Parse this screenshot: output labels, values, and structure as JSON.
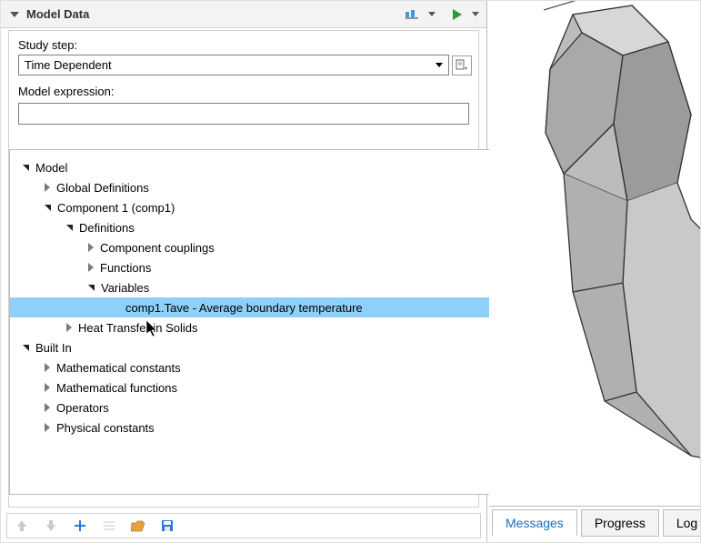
{
  "panel": {
    "title": "Model Data",
    "study_step_label": "Study step:",
    "study_step_value": "Time Dependent",
    "model_expression_label": "Model expression:",
    "model_expression_value": ""
  },
  "tree": {
    "items": [
      {
        "depth": 0,
        "state": "open",
        "label": "Model"
      },
      {
        "depth": 1,
        "state": "closed",
        "label": "Global Definitions"
      },
      {
        "depth": 1,
        "state": "open",
        "label": "Component 1 (comp1)"
      },
      {
        "depth": 2,
        "state": "open",
        "label": "Definitions"
      },
      {
        "depth": 3,
        "state": "closed",
        "label": "Component couplings"
      },
      {
        "depth": 3,
        "state": "closed",
        "label": "Functions"
      },
      {
        "depth": 3,
        "state": "open",
        "label": "Variables"
      },
      {
        "depth": 4,
        "state": "leaf",
        "label": "comp1.Tave - Average boundary temperature",
        "selected": true
      },
      {
        "depth": 2,
        "state": "closed",
        "label": "Heat Transfer in Solids"
      },
      {
        "depth": 0,
        "state": "open",
        "label": "Built In"
      },
      {
        "depth": 1,
        "state": "closed",
        "label": "Mathematical constants"
      },
      {
        "depth": 1,
        "state": "closed",
        "label": "Mathematical functions"
      },
      {
        "depth": 1,
        "state": "closed",
        "label": "Operators"
      },
      {
        "depth": 1,
        "state": "closed",
        "label": "Physical constants"
      }
    ]
  },
  "tabs": {
    "messages": "Messages",
    "progress": "Progress",
    "log": "Log"
  },
  "icons": {
    "plot": "plot-icon",
    "run": "run-icon",
    "insert_ref": "insert-ref-icon",
    "up": "arrow-up-icon",
    "down": "arrow-down-icon",
    "add": "plus-icon",
    "list": "list-icon",
    "folder": "folder-open-icon",
    "save": "diskette-icon"
  }
}
